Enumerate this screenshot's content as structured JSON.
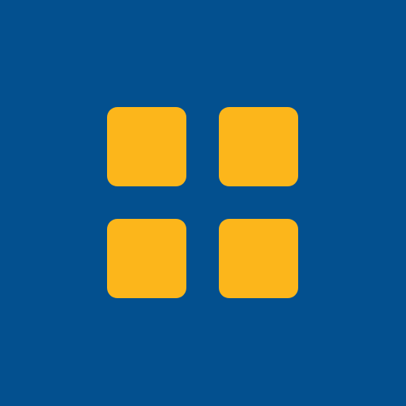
{
  "icon": {
    "name": "grid-app-icon",
    "background_color": "#03508f",
    "tile_color": "#fcb61b",
    "tiles": [
      {
        "name": "tile-top-left"
      },
      {
        "name": "tile-top-right"
      },
      {
        "name": "tile-bottom-left"
      },
      {
        "name": "tile-bottom-right"
      }
    ]
  }
}
